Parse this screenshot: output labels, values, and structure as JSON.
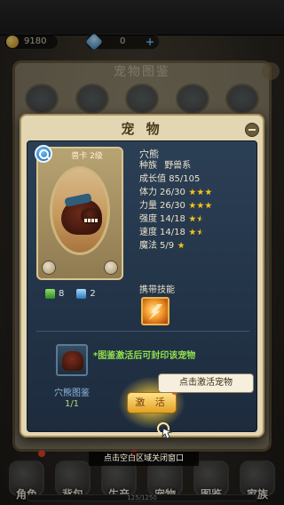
{
  "resources": {
    "gold": "9180",
    "gems": "0"
  },
  "album": {
    "title": "宠物图鉴",
    "tabs": [
      "",
      "",
      "",
      "",
      ""
    ]
  },
  "dialog": {
    "title": "宠 物",
    "card_level": "兽卡  2级",
    "card_res": [
      {
        "icon": "green-crystal-icon",
        "value": "8"
      },
      {
        "icon": "blue-crystal-icon",
        "value": "2"
      }
    ],
    "pet": {
      "name": "穴熊",
      "race_label": "种族",
      "race": "野兽系",
      "growth_label": "成长值",
      "growth": "85/105",
      "stats": [
        {
          "label": "体力",
          "value": "26/30",
          "stars": 3
        },
        {
          "label": "力量",
          "value": "26/30",
          "stars": 3
        },
        {
          "label": "强度",
          "value": "14/18",
          "stars": 1.5
        },
        {
          "label": "速度",
          "value": "14/18",
          "stars": 1.5
        },
        {
          "label": "魔法",
          "value": "5/9",
          "stars": 1
        }
      ],
      "skills_label": "携带技能"
    },
    "collection": {
      "name": "穴熊图鉴",
      "count": "1/1",
      "tip": "*图鉴激活后可封印该宠物"
    },
    "activate_label": "激 活",
    "tooltip": "点击激活宠物"
  },
  "close_hint": "点击空白区域关闭窗口",
  "nav": [
    {
      "label": "角色",
      "badge": true
    },
    {
      "label": "背包",
      "badge": false
    },
    {
      "label": "生产",
      "badge": true
    },
    {
      "label": "宠物",
      "badge": false
    },
    {
      "label": "图鉴",
      "badge": false
    },
    {
      "label": "家族",
      "badge": false
    }
  ],
  "xp": "125/1250",
  "colors": {
    "accent_gold": "#f4c21c",
    "panel_blue": "#2b3f55",
    "frame_tan": "#e3d6b2",
    "tip_green": "#8fe04a"
  }
}
